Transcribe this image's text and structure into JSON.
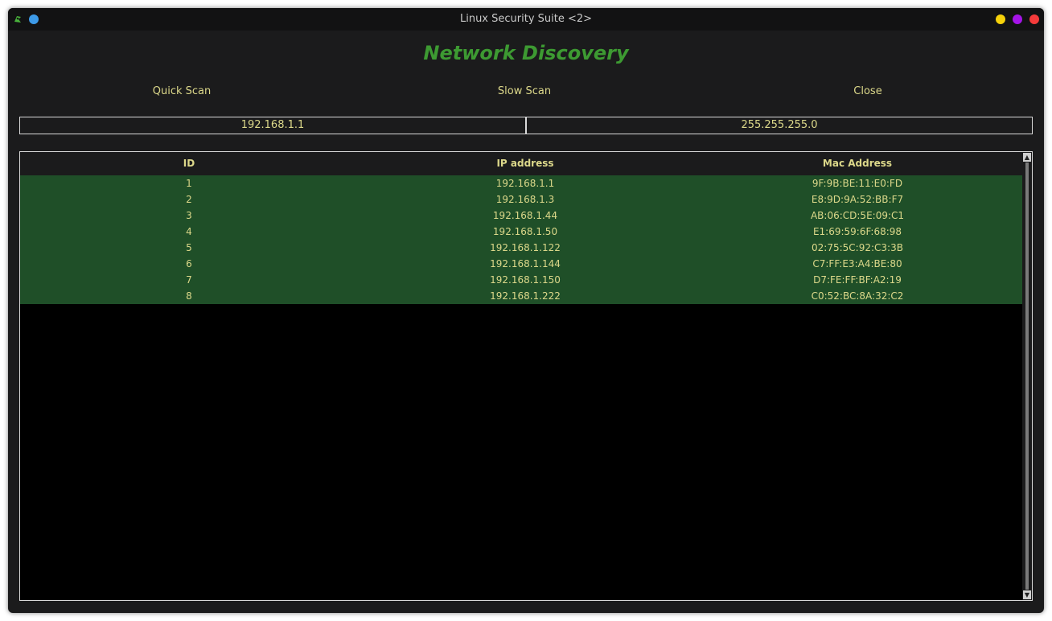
{
  "window": {
    "title": "Linux Security Suite <2>",
    "controls": {
      "left_dot_color": "#3d9ae8",
      "minimize_color": "#f5d10a",
      "maximize_color": "#a514e8",
      "close_color": "#f53b3b"
    }
  },
  "page": {
    "heading": "Network Discovery"
  },
  "actions": {
    "quick_scan": "Quick Scan",
    "slow_scan": "Slow Scan",
    "close": "Close"
  },
  "inputs": {
    "ip": "192.168.1.1",
    "netmask": "255.255.255.0"
  },
  "table": {
    "columns": [
      "ID",
      "IP address",
      "Mac Address"
    ],
    "rows": [
      [
        "1",
        "192.168.1.1",
        "9F:9B:BE:11:E0:FD"
      ],
      [
        "2",
        "192.168.1.3",
        "E8:9D:9A:52:BB:F7"
      ],
      [
        "3",
        "192.168.1.44",
        "AB:06:CD:5E:09:C1"
      ],
      [
        "4",
        "192.168.1.50",
        "E1:69:59:6F:68:98"
      ],
      [
        "5",
        "192.168.1.122",
        "02:75:5C:92:C3:3B"
      ],
      [
        "6",
        "192.168.1.144",
        "C7:FF:E3:A4:BE:80"
      ],
      [
        "7",
        "192.168.1.150",
        "D7:FE:FF:BF:A2:19"
      ],
      [
        "8",
        "192.168.1.222",
        "C0:52:BC:8A:32:C2"
      ]
    ]
  },
  "colors": {
    "accent_green": "#3d9a32",
    "row_highlight": "#1f4f28",
    "text_yellow": "#dcd88a"
  }
}
